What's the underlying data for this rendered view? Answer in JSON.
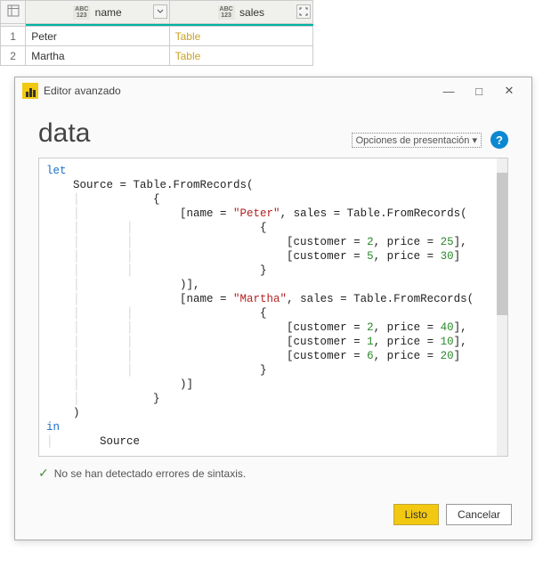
{
  "table": {
    "columns": [
      {
        "name": "name",
        "type_label": "ABC123",
        "control": "dropdown"
      },
      {
        "name": "sales",
        "type_label": "ABC123",
        "control": "expand"
      }
    ],
    "rows": [
      {
        "num": "1",
        "name": "Peter",
        "sales": "Table"
      },
      {
        "num": "2",
        "name": "Martha",
        "sales": "Table"
      }
    ]
  },
  "editor": {
    "title": "Editor avanzado",
    "headline": "data",
    "options_label": "Opciones de presentación",
    "help_symbol": "?",
    "status_icon": "✓",
    "status_text": "No se han detectado errores de sintaxis.",
    "btn_ok": "Listo",
    "btn_cancel": "Cancelar",
    "win": {
      "min": "—",
      "max": "□",
      "close": "✕"
    },
    "code": {
      "l1_kw": "let",
      "l2": "    Source = Table.FromRecords(",
      "l3": "        {",
      "l4_a": "            [name = ",
      "l4_str": "\"Peter\"",
      "l4_b": ", sales = Table.FromRecords(",
      "l5": "                {",
      "l6_a": "                    [customer = ",
      "l6_n1": "2",
      "l6_b": ", price = ",
      "l6_n2": "25",
      "l6_c": "],",
      "l7_a": "                    [customer = ",
      "l7_n1": "5",
      "l7_b": ", price = ",
      "l7_n2": "30",
      "l7_c": "]",
      "l8": "                }",
      "l9": "            )],",
      "l10_a": "            [name = ",
      "l10_str": "\"Martha\"",
      "l10_b": ", sales = Table.FromRecords(",
      "l11": "                {",
      "l12_a": "                    [customer = ",
      "l12_n1": "2",
      "l12_b": ", price = ",
      "l12_n2": "40",
      "l12_c": "],",
      "l13_a": "                    [customer = ",
      "l13_n1": "1",
      "l13_b": ", price = ",
      "l13_n2": "10",
      "l13_c": "],",
      "l14_a": "                    [customer = ",
      "l14_n1": "6",
      "l14_b": ", price = ",
      "l14_n2": "20",
      "l14_c": "]",
      "l15": "                }",
      "l16": "            )]",
      "l17": "        }",
      "l18": "    )",
      "l19_kw": "in",
      "l20": "    Source"
    }
  }
}
